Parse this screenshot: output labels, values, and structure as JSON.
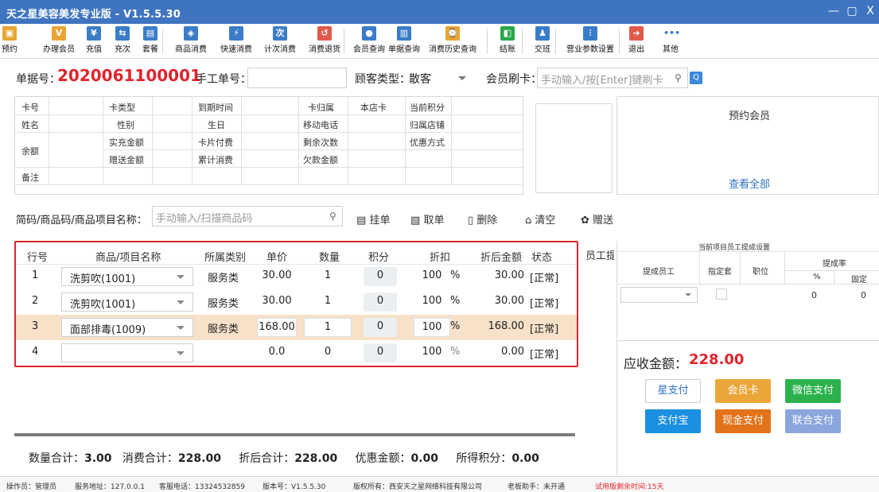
{
  "window": {
    "title": "天之星美容美发专业版 - V1.5.5.30",
    "controls": [
      "—",
      "▢",
      "X"
    ]
  },
  "toolbar": {
    "items": [
      {
        "label": "预约",
        "icon": "calendar-icon",
        "color": "#e8a534"
      },
      {
        "label": "办理会员",
        "icon": "vip-card-icon",
        "color": "#e8a534"
      },
      {
        "label": "充值",
        "icon": "yen-icon",
        "color": "#3a7cc8"
      },
      {
        "label": "充次",
        "icon": "recharge-times-icon",
        "color": "#3a7cc8"
      },
      {
        "label": "套餐",
        "icon": "package-icon",
        "color": "#3a7cc8"
      },
      {
        "label": "商品消费",
        "icon": "goods-consume-icon",
        "color": "#3a7cc8"
      },
      {
        "label": "快速消费",
        "icon": "quick-consume-icon",
        "color": "#3a7cc8"
      },
      {
        "label": "计次消费",
        "icon": "count-consume-icon",
        "color": "#3a7cc8"
      },
      {
        "label": "消费退货",
        "icon": "return-icon",
        "color": "#e05a4a"
      },
      {
        "label": "会员查询",
        "icon": "member-search-icon",
        "color": "#3a7cc8"
      },
      {
        "label": "单据查询",
        "icon": "bill-search-icon",
        "color": "#3a7cc8"
      },
      {
        "label": "消费历史查询",
        "icon": "history-icon",
        "color": "#e8a534"
      },
      {
        "label": "结账",
        "icon": "checkout-icon",
        "color": "#2aa84a"
      },
      {
        "label": "交班",
        "icon": "shift-icon",
        "color": "#3a7cc8"
      },
      {
        "label": "营业参数设置",
        "icon": "settings-icon",
        "color": "#3a7cc8"
      },
      {
        "label": "退出",
        "icon": "exit-icon",
        "color": "#e05a4a"
      },
      {
        "label": "其他",
        "icon": "more-icon",
        "color": "#3a7cc8"
      }
    ]
  },
  "doc": {
    "number_label": "单据号：",
    "number": "2020061100001",
    "manual_label": "手工单号：",
    "customer_type_label": "顾客类型：",
    "customer_type": "散客",
    "card_label": "会员刷卡：",
    "card_placeholder": "手动输入/按[Enter]键刷卡"
  },
  "member": {
    "labels": {
      "card_no": "卡号",
      "card_type": "卡类型",
      "expire": "到期时间",
      "card_owner": "卡归属",
      "this_store": "本店卡",
      "points": "当前积分",
      "name": "姓名",
      "gender": "性别",
      "birthday": "生日",
      "mobile": "移动电话",
      "home_store": "归属店铺",
      "balance": "余额",
      "real_recharge": "实充金额",
      "card_fee": "卡片付费",
      "remain_times": "剩余次数",
      "discount_type": "优惠方式",
      "gift_amount": "赠送金额",
      "total_consume": "累计消费",
      "owed": "欠款金额",
      "remark": "备注"
    }
  },
  "appointment": {
    "title": "预约会员",
    "view_all": "查看全部"
  },
  "search": {
    "label": "简码/商品码/商品项目名称：",
    "placeholder": "手动输入/扫描商品码",
    "actions": [
      "挂单",
      "取单",
      "删除",
      "清空",
      "赠送"
    ]
  },
  "items": {
    "headers": [
      "行号",
      "商品/项目名称",
      "所属类别",
      "单价",
      "数量",
      "积分",
      "折扣",
      "折后金额",
      "状态",
      "员工提"
    ],
    "rows": [
      {
        "no": "1",
        "name": "洗剪吹(1001)",
        "category": "服务类",
        "price": "30.00",
        "qty": "1",
        "points": "0",
        "discount": "100",
        "pct": "%",
        "amount": "30.00",
        "status": "[正常]",
        "selected": false
      },
      {
        "no": "2",
        "name": "洗剪吹(1001)",
        "category": "服务类",
        "price": "30.00",
        "qty": "1",
        "points": "0",
        "discount": "100",
        "pct": "%",
        "amount": "30.00",
        "status": "[正常]",
        "selected": false
      },
      {
        "no": "3",
        "name": "面部排毒(1009)",
        "category": "服务类",
        "price": "168.00",
        "qty": "1",
        "points": "0",
        "discount": "100",
        "pct": "%",
        "amount": "168.00",
        "status": "[正常]",
        "selected": true
      },
      {
        "no": "4",
        "name": "",
        "category": "",
        "price": "0.0",
        "qty": "0",
        "points": "0",
        "discount": "100",
        "pct": "%",
        "amount": "0.00",
        "status": "[正常]",
        "selected": false
      }
    ]
  },
  "commission": {
    "title": "当前项目员工提成设置",
    "employee": "提成员工",
    "assigned": "指定套",
    "position": "职位",
    "rate": "提成率",
    "pct": "%",
    "fixed": "固定",
    "row": {
      "pct": "0",
      "fixed": "0"
    }
  },
  "payment": {
    "receivable_label": "应收金额：",
    "receivable": "228.00",
    "buttons": [
      {
        "label": "星支付",
        "style": "outline"
      },
      {
        "label": "会员卡",
        "color": "#eba63a"
      },
      {
        "label": "微信支付",
        "color": "#2bb24c"
      },
      {
        "label": "支付宝",
        "color": "#1b8fe0"
      },
      {
        "label": "现金支付",
        "color": "#e2731a"
      },
      {
        "label": "联合支付",
        "color": "#8aa6dc"
      }
    ]
  },
  "totals": {
    "qty_label": "数量合计：",
    "qty": "3.00",
    "consume_label": "消费合计：",
    "consume": "228.00",
    "after_label": "折后合计：",
    "after": "228.00",
    "discount_label": "优惠金额：",
    "discount": "0.00",
    "points_label": "所得积分：",
    "points": "0.00"
  },
  "status": {
    "operator": "操作员：管理员",
    "server": "服务地址：127.0.0.1",
    "phone": "客服电话：13324532859",
    "version": "版本号：V1.5.5.30",
    "copyright": "版权所有：西安天之星网络科技有限公司",
    "boss": "老板助手：未开通",
    "trial": "试用版剩余时间:15天"
  }
}
